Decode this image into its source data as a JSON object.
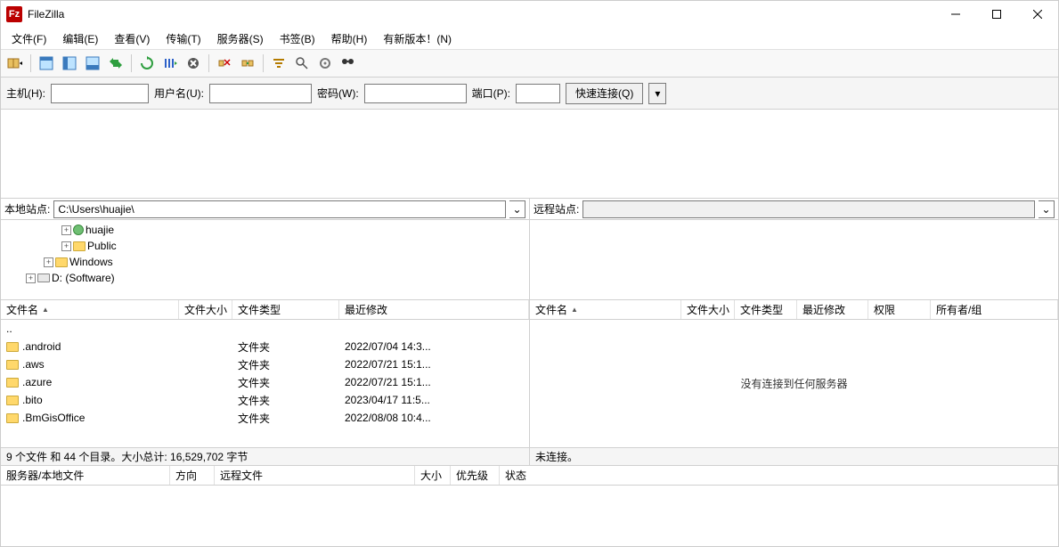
{
  "app": {
    "title": "FileZilla"
  },
  "menu": {
    "file": "文件(F)",
    "edit": "编辑(E)",
    "view": "查看(V)",
    "transfer": "传输(T)",
    "server": "服务器(S)",
    "bookmarks": "书签(B)",
    "help": "帮助(H)",
    "new_version": "有新版本！(N)"
  },
  "quickconnect": {
    "host_label": "主机(H):",
    "user_label": "用户名(U):",
    "pass_label": "密码(W):",
    "port_label": "端口(P):",
    "button": "快速连接(Q)",
    "host": "",
    "user": "",
    "pass": "",
    "port": ""
  },
  "local": {
    "site_label": "本地站点:",
    "path": "C:\\Users\\huajie\\",
    "tree": [
      {
        "indent": 60,
        "expander": "+",
        "icon": "user",
        "label": "huajie"
      },
      {
        "indent": 60,
        "expander": "+",
        "icon": "folder",
        "label": "Public"
      },
      {
        "indent": 40,
        "expander": "+",
        "icon": "folder",
        "label": "Windows"
      },
      {
        "indent": 20,
        "expander": "+",
        "icon": "drive",
        "label": "D: (Software)"
      }
    ],
    "columns": {
      "name": "文件名",
      "size": "文件大小",
      "type": "文件类型",
      "modified": "最近修改"
    },
    "rows": [
      {
        "name": "..",
        "size": "",
        "type": "",
        "modified": ""
      },
      {
        "name": ".android",
        "size": "",
        "type": "文件夹",
        "modified": "2022/07/04 14:3..."
      },
      {
        "name": ".aws",
        "size": "",
        "type": "文件夹",
        "modified": "2022/07/21 15:1..."
      },
      {
        "name": ".azure",
        "size": "",
        "type": "文件夹",
        "modified": "2022/07/21 15:1..."
      },
      {
        "name": ".bito",
        "size": "",
        "type": "文件夹",
        "modified": "2023/04/17 11:5..."
      },
      {
        "name": ".BmGisOffice",
        "size": "",
        "type": "文件夹",
        "modified": "2022/08/08 10:4..."
      }
    ],
    "status": "9 个文件 和 44 个目录。大小总计: 16,529,702 字节"
  },
  "remote": {
    "site_label": "远程站点:",
    "path": "",
    "columns": {
      "name": "文件名",
      "size": "文件大小",
      "type": "文件类型",
      "modified": "最近修改",
      "perm": "权限",
      "owner": "所有者/组"
    },
    "empty_msg": "没有连接到任何服务器",
    "status": "未连接。"
  },
  "queue": {
    "columns": {
      "serverfile": "服务器/本地文件",
      "direction": "方向",
      "remotefile": "远程文件",
      "size": "大小",
      "priority": "优先级",
      "state": "状态"
    }
  }
}
